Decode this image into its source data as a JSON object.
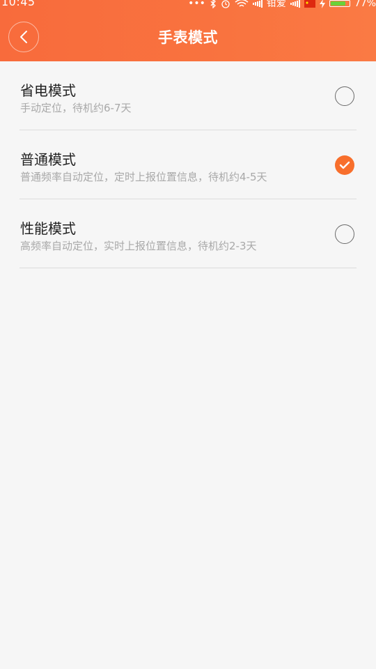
{
  "status_bar": {
    "time": "10:45",
    "dots": "•••",
    "carrier": "钳爱",
    "battery_percent": "77%",
    "battery_level": 0.77
  },
  "header": {
    "title": "手表模式",
    "accent_color": "#f86b3c"
  },
  "modes": [
    {
      "title": "省电模式",
      "description": "手动定位，待机约6-7天",
      "selected": false
    },
    {
      "title": "普通模式",
      "description": "普通频率自动定位，定时上报位置信息，待机约4-5天",
      "selected": true
    },
    {
      "title": "性能模式",
      "description": "高频率自动定位，实时上报位置信息，待机约2-3天",
      "selected": false
    }
  ],
  "colors": {
    "selected_radio": "#f86f2c",
    "title_text": "#222222",
    "desc_text": "#a8a8a8"
  },
  "icons": {
    "back": "chevron-left-icon",
    "selected": "checkmark-icon",
    "unselected": "radio-empty-icon"
  }
}
